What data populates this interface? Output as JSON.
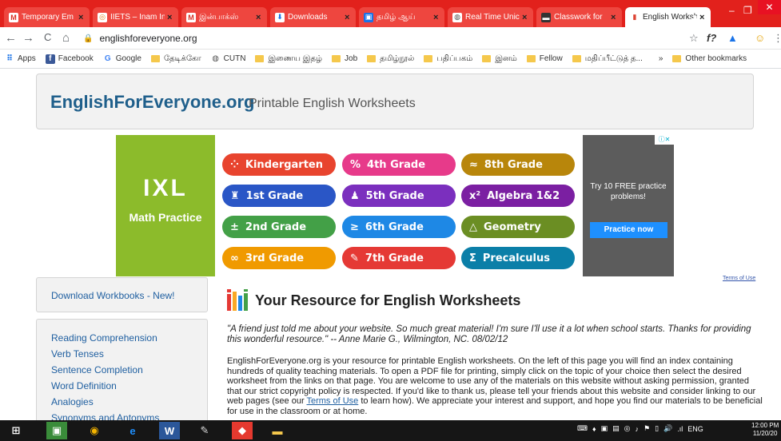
{
  "browser": {
    "tabs": [
      {
        "title": "Temporary Em",
        "icon": "gmail-icon",
        "icon_glyph": "M",
        "icon_color": "#d93025",
        "icon_bg": "#fff"
      },
      {
        "title": "IIETS – Inam Inf",
        "icon": "site-icon",
        "icon_glyph": "◎",
        "icon_color": "#e67e22",
        "icon_bg": "#fff"
      },
      {
        "title": "இன்பாக்ஸ்",
        "icon": "gmail-icon",
        "icon_glyph": "M",
        "icon_color": "#d93025",
        "icon_bg": "#fff"
      },
      {
        "title": "Downloads",
        "icon": "download-icon",
        "icon_glyph": "⬇",
        "icon_color": "#1a73e8",
        "icon_bg": "#fff"
      },
      {
        "title": "தமிழ் ஆய்",
        "icon": "site-icon",
        "icon_glyph": "▣",
        "icon_color": "#fff",
        "icon_bg": "#1a73e8"
      },
      {
        "title": "Real Time Unic",
        "icon": "globe-icon",
        "icon_glyph": "◍",
        "icon_color": "#555",
        "icon_bg": "#fff"
      },
      {
        "title": "Classwork for",
        "icon": "classroom-icon",
        "icon_glyph": "▬",
        "icon_color": "#fff",
        "icon_bg": "#333"
      },
      {
        "title": "English Worksh",
        "icon": "efe-icon",
        "icon_glyph": "▮",
        "icon_color": "#d43",
        "icon_bg": "#fff",
        "active": true
      }
    ],
    "new_tab": "+",
    "window_controls": {
      "minimize": "–",
      "restore": "❐",
      "close": "✕"
    },
    "nav": {
      "back": "←",
      "forward": "→",
      "reload": "C",
      "home": "⌂"
    },
    "url": "englishforeveryone.org",
    "toolbar_icons": {
      "star": "☆",
      "ext1": "f?",
      "ext2": "▲",
      "ext3": "☺",
      "menu": "⋮"
    }
  },
  "bookmarks": [
    {
      "label": "Apps",
      "type": "apps"
    },
    {
      "label": "Facebook",
      "type": "facebook"
    },
    {
      "label": "Google",
      "type": "google"
    },
    {
      "label": "தேடிக்கோ",
      "type": "folder"
    },
    {
      "label": "CUTN",
      "type": "globe"
    },
    {
      "label": "இணைய இதழ்",
      "type": "folder"
    },
    {
      "label": "Job",
      "type": "folder"
    },
    {
      "label": "தமிழ்நூல்",
      "type": "folder"
    },
    {
      "label": "பதிப்பகம்",
      "type": "folder"
    },
    {
      "label": "இனம்",
      "type": "folder"
    },
    {
      "label": "Fellow",
      "type": "folder"
    },
    {
      "label": "மதிப்பீட்டுத் த...",
      "type": "folder"
    },
    {
      "label": "»",
      "type": "more"
    },
    {
      "label": "Other bookmarks",
      "type": "folder"
    }
  ],
  "header": {
    "site_name": "EnglishForEveryone.org",
    "tagline": "Printable English Worksheets"
  },
  "ad": {
    "brand": "IXL",
    "subtitle": "Math Practice",
    "grades": [
      {
        "label": "Kindergarten",
        "icon": "⁘",
        "color": "#e8442e"
      },
      {
        "label": "4th Grade",
        "icon": "%",
        "color": "#e73a8a"
      },
      {
        "label": "8th Grade",
        "icon": "≈",
        "color": "#b8860b"
      },
      {
        "label": "1st Grade",
        "icon": "♜",
        "color": "#2a56c6"
      },
      {
        "label": "5th Grade",
        "icon": "♟",
        "color": "#7b2fbe"
      },
      {
        "label": "Algebra 1&2",
        "icon": "x²",
        "color": "#7b1fa2"
      },
      {
        "label": "2nd Grade",
        "icon": "±",
        "color": "#43a047"
      },
      {
        "label": "6th Grade",
        "icon": "≥",
        "color": "#1e88e5"
      },
      {
        "label": "Geometry",
        "icon": "△",
        "color": "#6b8e23"
      },
      {
        "label": "3rd Grade",
        "icon": "∞",
        "color": "#f09a00"
      },
      {
        "label": "7th Grade",
        "icon": "✎",
        "color": "#e53935"
      },
      {
        "label": "Precalculus",
        "icon": "Σ",
        "color": "#0b7fa8"
      }
    ],
    "promo": "Try 10 FREE practice problems!",
    "cta": "Practice now",
    "adchoice": "ⓘ✕",
    "terms": "Terms of Use"
  },
  "sidebar": {
    "top_link": "Download Workbooks - New!",
    "links": [
      "Reading Comprehension",
      "Verb Tenses",
      "Sentence Completion",
      "Word Definition",
      "Analogies",
      "Synonyms and Antonyms"
    ]
  },
  "main": {
    "heading": "Your Resource for English Worksheets",
    "quote": "\"A friend just told me about your website. So much great material! I'm sure I'll use it a lot when school starts. Thanks for providing this wonderful resource.\" -- Anne Marie G., Wilmington, NC. 08/02/12",
    "intro_before": "EnglishForEveryone.org is your resource for printable English worksheets. On the left of this page you will find an index containing hundreds of quality teaching materials. To open a PDF file for printing, simply click on the topic of your choice then select the desired worksheet from the links on that page. You are welcome to use any of the materials on this website without asking permission, granted that our strict copyright policy is respected. If you'd like to thank us, please tell your friends about this website and consider linking to our web pages (see our ",
    "intro_link": "Terms of Use",
    "intro_after": " to learn how). We appreciate your interest and support, and hope you find our materials to be beneficial for use in the classroom or at home."
  },
  "taskbar": {
    "apps": [
      {
        "name": "start-button",
        "glyph": "⊞",
        "color": "#fff",
        "bg": "transparent"
      },
      {
        "name": "store-app",
        "glyph": "▣",
        "color": "#fff",
        "bg": "#3a8c3a"
      },
      {
        "name": "chrome-app",
        "glyph": "◉",
        "color": "#f4b400",
        "bg": "transparent"
      },
      {
        "name": "ie-app",
        "glyph": "e",
        "color": "#1e90ff",
        "bg": "transparent"
      },
      {
        "name": "word-app",
        "glyph": "W",
        "color": "#fff",
        "bg": "#2b579a"
      },
      {
        "name": "paint-app",
        "glyph": "✎",
        "color": "#ddd",
        "bg": "transparent"
      },
      {
        "name": "anydesk-app",
        "glyph": "◆",
        "color": "#fff",
        "bg": "#e5392f"
      },
      {
        "name": "explorer-app",
        "glyph": "▬",
        "color": "#f5c84c",
        "bg": "transparent"
      }
    ],
    "tray": [
      "⌨",
      "♦",
      "▣",
      "▤",
      "◎",
      "♪",
      "⚑",
      "▯",
      "🔊",
      ".ıl",
      "ENG"
    ],
    "time": "12:00 PM",
    "date": "11/20/20"
  }
}
